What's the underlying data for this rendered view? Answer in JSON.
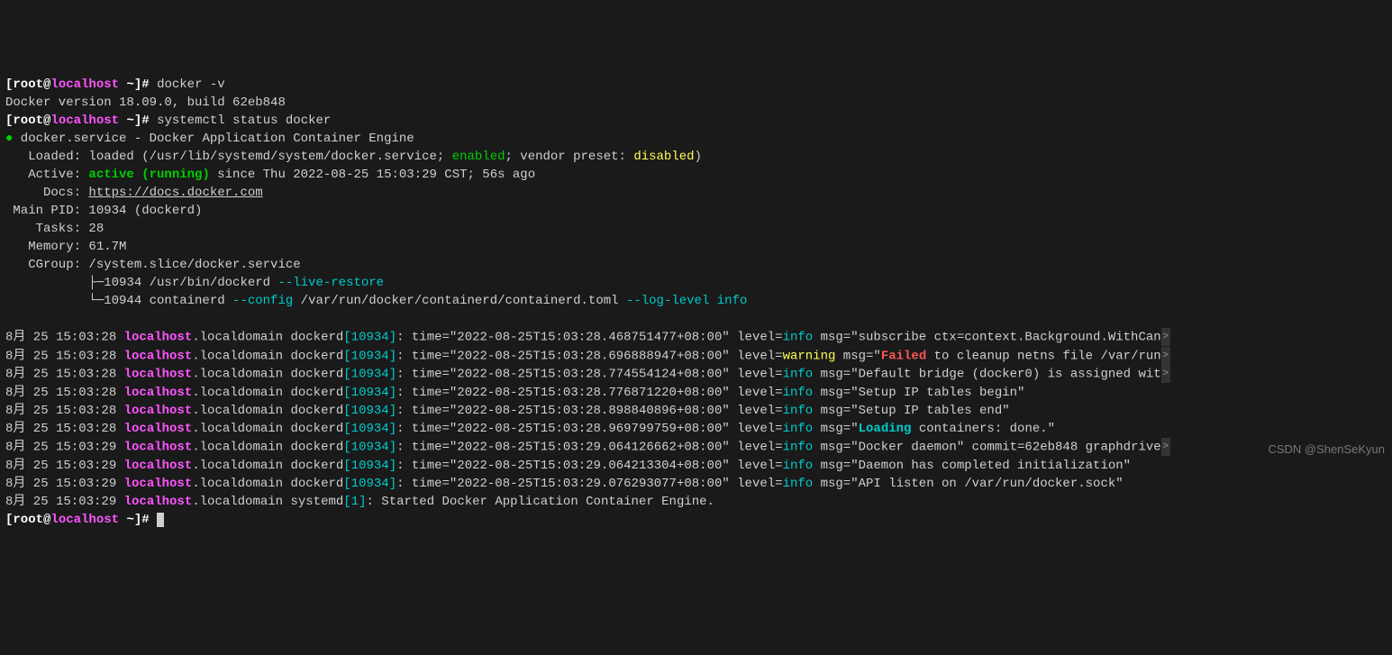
{
  "prompt": {
    "lbracket": "[",
    "user": "root",
    "at": "@",
    "host": "localhost",
    "path": " ~",
    "rbracket": "]",
    "symbol": "# "
  },
  "cmd1": "docker -v",
  "version_line": "Docker version 18.09.0, build 62eb848",
  "cmd2": "systemctl status docker",
  "status": {
    "bullet": "●",
    "service_line": " docker.service - Docker Application Container Engine",
    "loaded_label": "   Loaded: ",
    "loaded_pre": "loaded (/usr/lib/systemd/system/docker.service; ",
    "loaded_enabled": "enabled",
    "loaded_mid": "; vendor preset: ",
    "loaded_disabled": "disabled",
    "loaded_post": ")",
    "active_label": "   Active: ",
    "active_state": "active (running)",
    "active_since": " since Thu 2022-08-25 15:03:29 CST; 56s ago",
    "docs_label": "     Docs: ",
    "docs_url": "https://docs.docker.com",
    "mainpid_label": " Main PID: ",
    "mainpid_value": "10934 (dockerd)",
    "tasks_label": "    Tasks: ",
    "tasks_value": "28",
    "memory_label": "   Memory: ",
    "memory_value": "61.7M",
    "cgroup_label": "   CGroup: ",
    "cgroup_path": "/system.slice/docker.service",
    "tree1_prefix": "           ├─10934 /usr/bin/dockerd ",
    "tree1_flag": "--live-restore",
    "tree2_prefix": "           └─10944 containerd ",
    "tree2_flag1": "--config",
    "tree2_mid": " /var/run/docker/containerd/containerd.toml ",
    "tree2_flag2": "--log-level",
    "tree2_end": " ",
    "tree2_val": "info"
  },
  "loglines": [
    {
      "date": "8月 25 15:03:28 ",
      "host": "localhost",
      "domain": ".localdomain dockerd",
      "pid": "10934",
      "after_pid": ": time=\"2022-08-25T15:03:28.468751477+08:00\" level=",
      "level": "info",
      "msg_pre": " msg=\"subscribe ctx=context.Background.WithCan",
      "msg_quote": "",
      "msg_post": "",
      "trunc": true
    },
    {
      "date": "8月 25 15:03:28 ",
      "host": "localhost",
      "domain": ".localdomain dockerd",
      "pid": "10934",
      "after_pid": ": time=\"2022-08-25T15:03:28.696888947+08:00\" level=",
      "level": "warning",
      "msg_pre": " msg=\"",
      "msg_quote": "Failed",
      "msg_post": " to cleanup netns file /var/run",
      "trunc": true
    },
    {
      "date": "8月 25 15:03:28 ",
      "host": "localhost",
      "domain": ".localdomain dockerd",
      "pid": "10934",
      "after_pid": ": time=\"2022-08-25T15:03:28.774554124+08:00\" level=",
      "level": "info",
      "msg_pre": " msg=\"Default bridge (docker0) is assigned wit",
      "msg_quote": "",
      "msg_post": "",
      "trunc": true
    },
    {
      "date": "8月 25 15:03:28 ",
      "host": "localhost",
      "domain": ".localdomain dockerd",
      "pid": "10934",
      "after_pid": ": time=\"2022-08-25T15:03:28.776871220+08:00\" level=",
      "level": "info",
      "msg_pre": " msg=\"Setup IP tables begin\"",
      "msg_quote": "",
      "msg_post": "",
      "trunc": false
    },
    {
      "date": "8月 25 15:03:28 ",
      "host": "localhost",
      "domain": ".localdomain dockerd",
      "pid": "10934",
      "after_pid": ": time=\"2022-08-25T15:03:28.898840896+08:00\" level=",
      "level": "info",
      "msg_pre": " msg=\"Setup IP tables end\"",
      "msg_quote": "",
      "msg_post": "",
      "trunc": false
    },
    {
      "date": "8月 25 15:03:28 ",
      "host": "localhost",
      "domain": ".localdomain dockerd",
      "pid": "10934",
      "after_pid": ": time=\"2022-08-25T15:03:28.969799759+08:00\" level=",
      "level": "info",
      "msg_pre": " msg=\"",
      "msg_quote": "Loading",
      "msg_post": " containers: done.\"",
      "trunc": false
    },
    {
      "date": "8月 25 15:03:29 ",
      "host": "localhost",
      "domain": ".localdomain dockerd",
      "pid": "10934",
      "after_pid": ": time=\"2022-08-25T15:03:29.064126662+08:00\" level=",
      "level": "info",
      "msg_pre": " msg=\"Docker daemon\" commit=62eb848 graphdrive",
      "msg_quote": "",
      "msg_post": "",
      "trunc": true
    },
    {
      "date": "8月 25 15:03:29 ",
      "host": "localhost",
      "domain": ".localdomain dockerd",
      "pid": "10934",
      "after_pid": ": time=\"2022-08-25T15:03:29.064213304+08:00\" level=",
      "level": "info",
      "msg_pre": " msg=\"Daemon has completed initialization\"",
      "msg_quote": "",
      "msg_post": "",
      "trunc": false
    },
    {
      "date": "8月 25 15:03:29 ",
      "host": "localhost",
      "domain": ".localdomain dockerd",
      "pid": "10934",
      "after_pid": ": time=\"2022-08-25T15:03:29.076293077+08:00\" level=",
      "level": "info",
      "msg_pre": " msg=\"API listen on /var/run/docker.sock\"",
      "msg_quote": "",
      "msg_post": "",
      "trunc": false
    },
    {
      "date": "8月 25 15:03:29 ",
      "host": "localhost",
      "domain": ".localdomain systemd",
      "pid": "1",
      "after_pid": ": Started Docker Application Container Engine.",
      "level": "",
      "msg_pre": "",
      "msg_quote": "",
      "msg_post": "",
      "trunc": false
    }
  ],
  "watermark": "CSDN @ShenSeKyun"
}
